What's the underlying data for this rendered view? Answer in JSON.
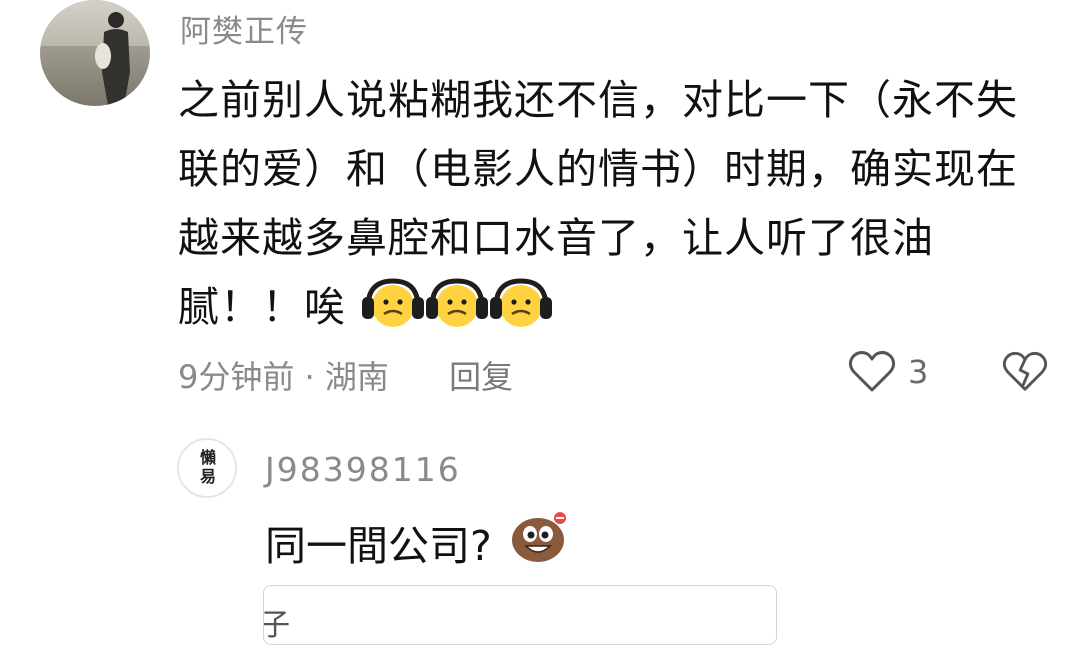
{
  "comment": {
    "author": "阿樊正传",
    "text": "之前别人说粘糊我还不信，对比一下（永不失联的爱）和（电影人的情书）时期，确实现在越来越多鼻腔和口水音了，让人听了很油腻！！唉",
    "emoji_count": 3,
    "emoji_icon": "headphones-worried-face-icon",
    "time": "9分钟前",
    "separator": "·",
    "location": "湖南",
    "reply_label": "回复",
    "likes": "3"
  },
  "reply": {
    "author": "J98398116",
    "avatar_text": "懶 易",
    "text": "同一間公司?",
    "emoji_icon": "grinning-bean-icon"
  },
  "input": {
    "partial_text": "子"
  },
  "colors": {
    "meta_gray": "#8a8a8a",
    "body_text": "#111111",
    "emoji_yellow": "#ffd23f",
    "emoji_headphone": "#1e1e1e",
    "bean_brown": "#8b5a3c"
  }
}
